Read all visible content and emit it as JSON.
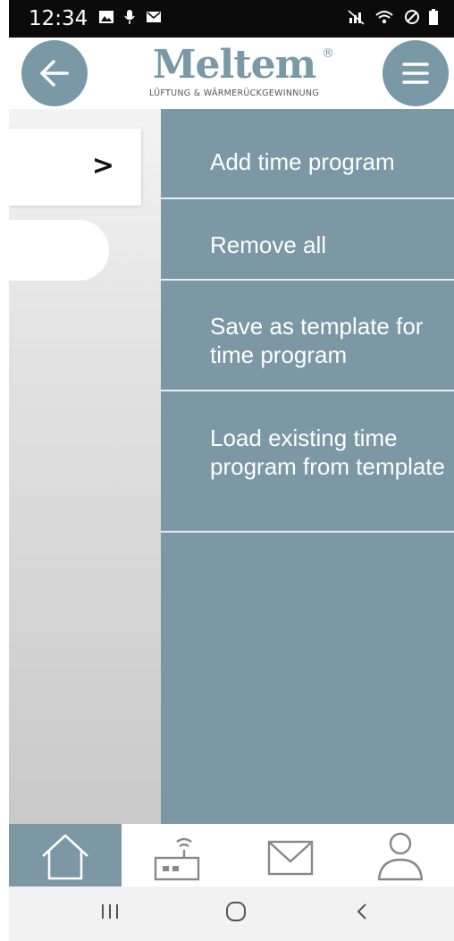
{
  "status_bar": {
    "time": "12:34",
    "icons_left": [
      "image-icon",
      "mic-icon",
      "mail-notification-icon"
    ],
    "icons_right": [
      "mute-icon",
      "wifi-icon",
      "block-icon",
      "battery-icon"
    ]
  },
  "header": {
    "logo_text": "Meltem",
    "logo_registered": "®",
    "logo_subtitle": "LÜFTUNG & WÄRMERÜCKGEWINNUNG",
    "back_icon": "arrow-left-icon",
    "menu_icon": "hamburger-menu-icon"
  },
  "left_pane": {
    "card_chevron": ">"
  },
  "menu": {
    "items": [
      {
        "label": "Add time program"
      },
      {
        "label": "Remove all"
      },
      {
        "label": "Save as template for time program"
      },
      {
        "label": "Load existing time program from template"
      }
    ]
  },
  "bottom_nav": {
    "tabs": [
      {
        "icon": "home-icon",
        "active": true
      },
      {
        "icon": "device-router-icon",
        "active": false
      },
      {
        "icon": "mail-icon",
        "active": false
      },
      {
        "icon": "user-icon",
        "active": false
      }
    ]
  },
  "system_nav": {
    "buttons": [
      "recent-apps-icon",
      "home-circle-icon",
      "back-chevron-icon"
    ]
  },
  "colors": {
    "accent": "#7b98a4",
    "status_bar": "#0b0b0b",
    "menu_text": "#ffffff"
  }
}
